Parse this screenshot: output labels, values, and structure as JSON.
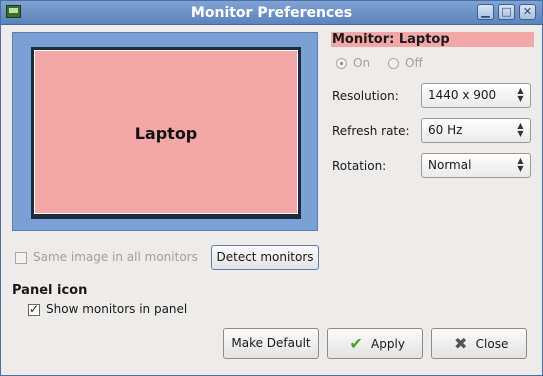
{
  "window": {
    "title": "Monitor Preferences"
  },
  "preview": {
    "monitor_label": "Laptop"
  },
  "monitor_panel": {
    "name": "Monitor: Laptop",
    "power": {
      "on_label": "On",
      "off_label": "Off",
      "selected": "On"
    },
    "resolution": {
      "label": "Resolution:",
      "value": "1440 x 900"
    },
    "refresh_rate": {
      "label": "Refresh rate:",
      "value": "60 Hz"
    },
    "rotation": {
      "label": "Rotation:",
      "value": "Normal"
    }
  },
  "options": {
    "same_image_label": "Same image in all monitors",
    "same_image_checked": false,
    "detect_button": "Detect monitors"
  },
  "panel_icon": {
    "heading": "Panel icon",
    "show_label": "Show monitors in panel",
    "show_checked": true
  },
  "buttons": {
    "make_default": "Make Default",
    "apply": "Apply",
    "close": "Close"
  },
  "colors": {
    "title_bar": "#5b83bd",
    "preview_background": "#7ba0d4",
    "monitor_fill": "#f4a7a7"
  }
}
